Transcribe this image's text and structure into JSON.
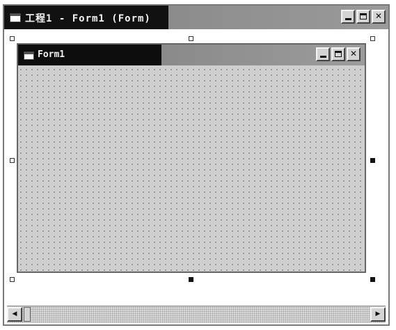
{
  "outer_window": {
    "title": "工程1 - Form1 (Form)",
    "buttons": {
      "minimize_icon": "minimize-icon",
      "maximize_icon": "maximize-icon",
      "close_glyph": "✕"
    }
  },
  "inner_form": {
    "title": "Form1",
    "buttons": {
      "minimize_icon": "minimize-icon",
      "maximize_icon": "maximize-icon",
      "close_glyph": "✕"
    }
  },
  "scrollbar": {
    "left_arrow": "◀",
    "right_arrow": "▶"
  }
}
